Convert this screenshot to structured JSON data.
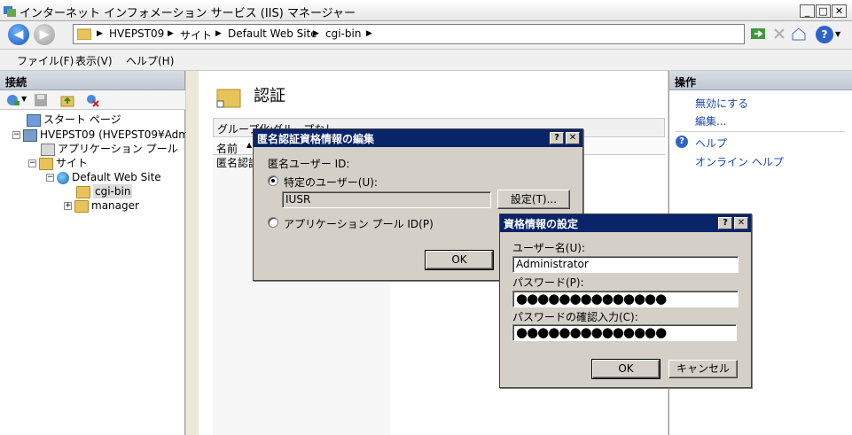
{
  "window": {
    "title": "インターネット インフォメーション サービス (IIS) マネージャー",
    "min": "_",
    "max": "□",
    "close": "✕"
  },
  "nav": {
    "breadcrumbs": [
      "HVEPST09",
      "サイト",
      "Default Web Site",
      "cgi-bin"
    ],
    "sep": "▶",
    "help": "?"
  },
  "menu": [
    "ファイル(F)",
    "表示(V)",
    "ヘルプ(H)"
  ],
  "left": {
    "header": "接続",
    "tree": [
      {
        "label": "スタート ページ"
      },
      {
        "label": "HVEPST09 (HVEPST09¥Admir"
      },
      {
        "label": "アプリケーション プール"
      },
      {
        "label": "サイト"
      },
      {
        "label": "Default Web Site"
      },
      {
        "label": "cgi-bin"
      },
      {
        "label": "manager"
      }
    ]
  },
  "center": {
    "title": "認証",
    "group_label": "グループ化:",
    "group_value": "グループなし",
    "col_name": "名前",
    "row_name": "匿名認証"
  },
  "right": {
    "header": "操作",
    "actions": [
      "無効にする",
      "編集...",
      "ヘルプ",
      "オンライン ヘルプ"
    ]
  },
  "dialog_anon": {
    "title": "匿名認証資格情報の編集",
    "help_btn": "?",
    "close_btn": "✕",
    "id_label": "匿名ユーザー ID:",
    "radio_specific": "特定のユーザー(U):",
    "user_value": "IUSR",
    "set_button": "設定(T)...",
    "radio_pool": "アプリケーション プール ID(P)",
    "ok": "OK"
  },
  "dialog_cred": {
    "title": "資格情報の設定",
    "help_btn": "?",
    "close_btn": "✕",
    "user_label": "ユーザー名(U):",
    "user_value": "Administrator",
    "pw_label": "パスワード(P):",
    "pw_value": "●●●●●●●●●●●●●●",
    "pw_confirm_label": "パスワードの確認入力(C):",
    "pw_confirm_value": "●●●●●●●●●●●●●●",
    "ok": "OK",
    "cancel": "キャンセル"
  },
  "colors": {
    "dialog_title": "#0a246a",
    "link": "#1b48b0"
  }
}
